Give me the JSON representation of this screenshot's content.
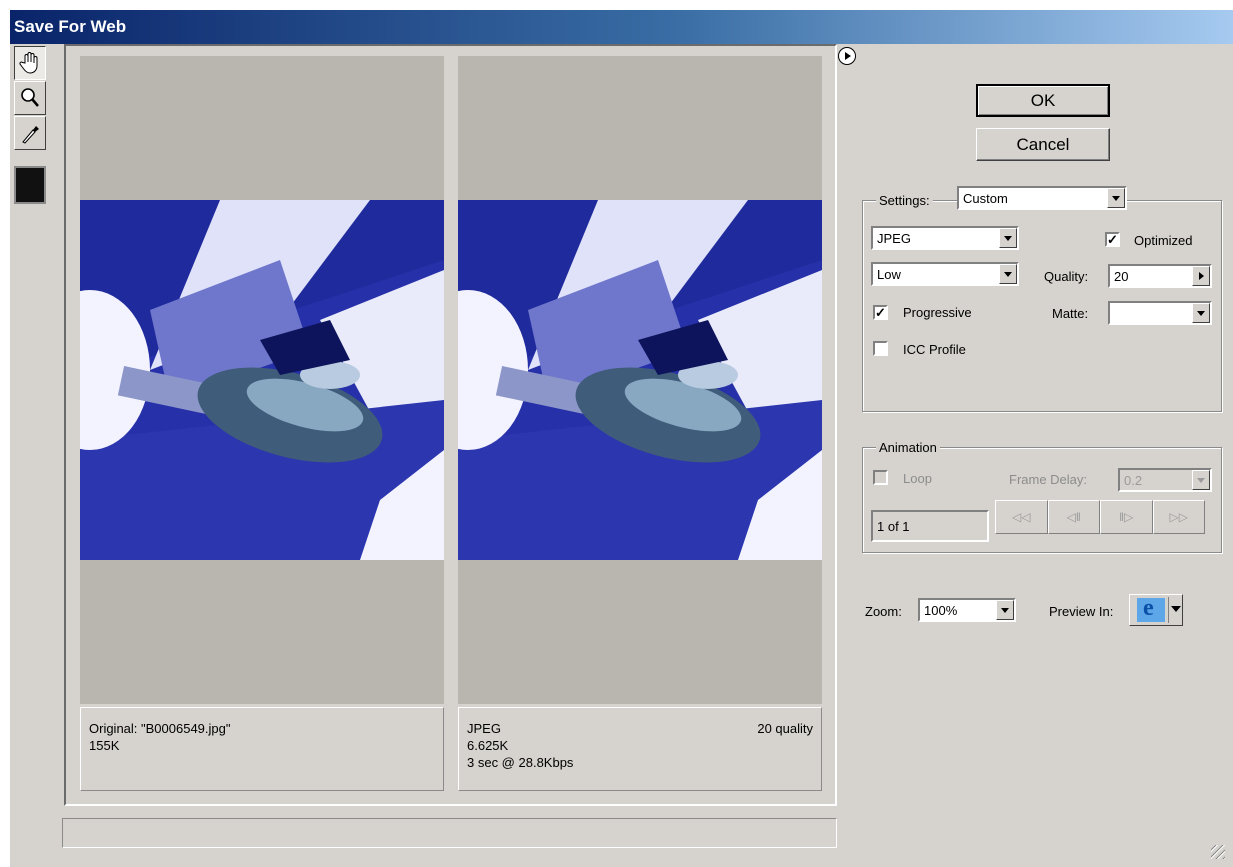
{
  "window": {
    "title": "Save For Web"
  },
  "tools": [
    "hand-tool",
    "zoom-tool",
    "eyedropper-tool"
  ],
  "original_pane": {
    "line1": "Original: \"B0006549.jpg\"",
    "line2": "155K"
  },
  "optimized_pane": {
    "line1": "JPEG",
    "quality_label": "20 quality",
    "line2": "6.625K",
    "line3": "3 sec @ 28.8Kbps"
  },
  "buttons": {
    "ok": "OK",
    "cancel": "Cancel"
  },
  "settings": {
    "label": "Settings:",
    "preset": "Custom",
    "format": "JPEG",
    "quality_preset": "Low",
    "optimized_label": "Optimized",
    "optimized": true,
    "quality_label": "Quality:",
    "quality": "20",
    "progressive_label": "Progressive",
    "progressive": true,
    "matte_label": "Matte:",
    "matte": "",
    "icc_label": "ICC Profile",
    "icc": false
  },
  "animation": {
    "label": "Animation",
    "loop_label": "Loop",
    "frame_delay_label": "Frame Delay:",
    "frame_delay": "0.2",
    "frame_counter": "1 of 1"
  },
  "zoom": {
    "label": "Zoom:",
    "value": "100%"
  },
  "preview": {
    "label": "Preview In:"
  },
  "icons": {
    "browser": "browser-icon"
  }
}
